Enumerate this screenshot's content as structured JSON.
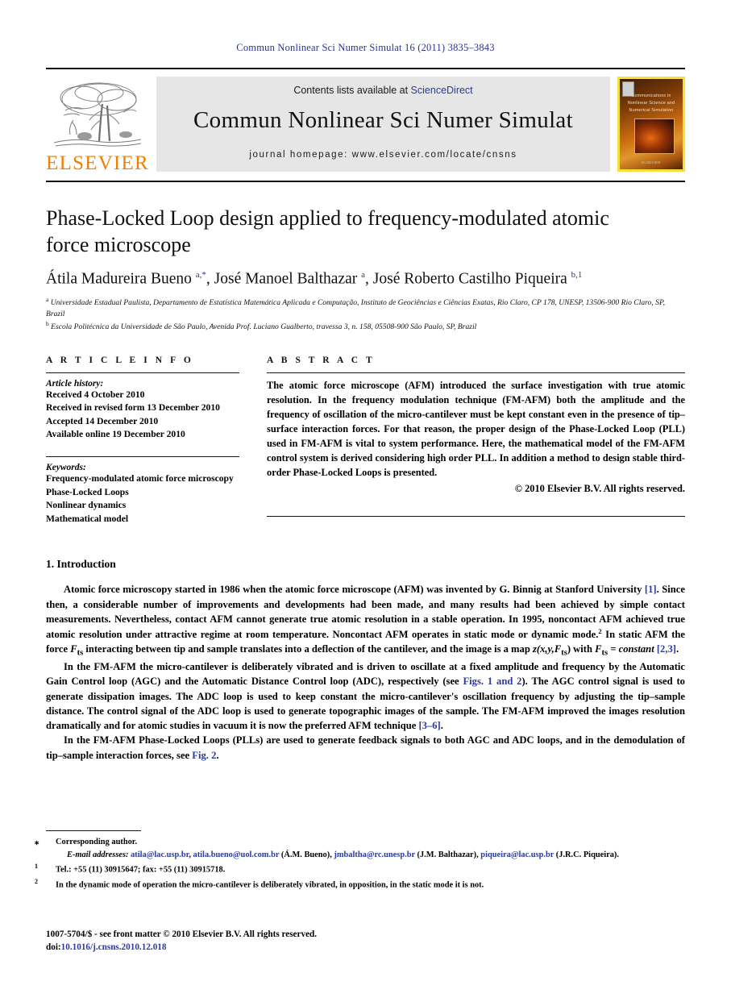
{
  "running_head": "Commun Nonlinear Sci Numer Simulat 16 (2011) 3835–3843",
  "masthead": {
    "contents_prefix": "Contents lists available at ",
    "sciencedirect": "ScienceDirect",
    "journal_name": "Commun Nonlinear Sci Numer Simulat",
    "homepage": "journal homepage: www.elsevier.com/locate/cnsns",
    "publisher_wordmark": "ELSEVIER",
    "cover_title": "Communications in Nonlinear Science and Numerical Simulation",
    "cover_footer": "ELSEVIER",
    "accent_orange": "#f08000",
    "link_blue": "#2b3a9c",
    "cover_border": "#f5e03c"
  },
  "article": {
    "title": "Phase-Locked Loop design applied to frequency-modulated atomic force microscope",
    "authors_html": "Átila Madureira Bueno <sup>a,*</sup>, José Manoel Balthazar <sup>a</sup>, José Roberto Castilho Piqueira <sup>b,1</sup>",
    "affiliation_a": "Universidade Estadual Paulista, Departamento de Estatística Matemática Aplicada e Computação, Instituto de Geociências e Ciências Exatas, Rio Claro, CP 178, UNESP, 13506-900 Rio Claro, SP, Brazil",
    "affiliation_b": "Escola Politécnica da Universidade de São Paulo, Avenida Prof. Luciano Gualberto, travessa 3, n. 158, 05508-900 São Paulo, SP, Brazil"
  },
  "article_info": {
    "heading": "A R T I C L E    I N F O",
    "history_label": "Article history:",
    "history": [
      "Received 4 October 2010",
      "Received in revised form 13 December 2010",
      "Accepted 14 December 2010",
      "Available online 19 December 2010"
    ],
    "keywords_label": "Keywords:",
    "keywords": [
      "Frequency-modulated atomic force microscopy",
      "Phase-Locked Loops",
      "Nonlinear dynamics",
      "Mathematical model"
    ]
  },
  "abstract": {
    "heading": "A B S T R A C T",
    "text": "The atomic force microscope (AFM) introduced the surface investigation with true atomic resolution. In the frequency modulation technique (FM-AFM) both the amplitude and the frequency of oscillation of the micro-cantilever must be kept constant even in the presence of tip–surface interaction forces. For that reason, the proper design of the Phase-Locked Loop (PLL) used in FM-AFM is vital to system performance. Here, the mathematical model of the FM-AFM control system is derived considering high order PLL. In addition a method to design stable third-order Phase-Locked Loops is presented.",
    "copyright": "© 2010 Elsevier B.V. All rights reserved."
  },
  "introduction": {
    "heading": "1. Introduction",
    "paragraph_1_parts": {
      "a": "Atomic force microscopy started in 1986 when the atomic force microscope (AFM) was invented by G. Binnig at Stanford University ",
      "ref1": "[1]",
      "b": ". Since then, a considerable number of improvements and developments had been made, and many results had been achieved by simple contact measurements. Nevertheless, contact AFM cannot generate true atomic resolution in a stable operation. In 1995, noncontact AFM achieved true atomic resolution under attractive regime at room temperature. Noncontact AFM operates in static mode or dynamic mode.",
      "fn2": "2",
      "c": " In static AFM the force ",
      "sym_fts1": "F",
      "sub_ts1": "ts",
      "d": " interacting between tip and sample translates into a deflection of the cantilever, and the image is a map ",
      "map": "z(x,y,F",
      "map_sub": "ts",
      "map_end": ") with ",
      "sym_fts2": "F",
      "sub_ts2": "ts",
      "e": " = constant ",
      "ref23": "[2,3]",
      "f": "."
    },
    "paragraph_2_parts": {
      "a": "In the FM-AFM the micro-cantilever is deliberately vibrated and is driven to oscillate at a fixed amplitude and frequency by the Automatic Gain Control loop (AGC) and the Automatic Distance Control loop (ADC), respectively (see ",
      "figs": "Figs. 1 and 2",
      "b": "). The AGC control signal is used to generate dissipation images. The ADC loop is used to keep constant the micro-cantilever's oscillation frequency by adjusting the tip–sample distance. The control signal of the ADC loop is used to generate topographic images of the sample. The FM-AFM improved the images resolution dramatically and for atomic studies in vacuum it is now the preferred AFM technique ",
      "ref36": "[3–6]",
      "c": "."
    },
    "paragraph_3_parts": {
      "a": "In the FM-AFM Phase-Locked Loops (PLLs) are used to generate feedback signals to both AGC and ADC loops, and in the demodulation of tip–sample interaction forces, see ",
      "fig2": "Fig. 2",
      "b": "."
    }
  },
  "footnotes": {
    "corresponding": "Corresponding author.",
    "corresponding_mark": "⁎",
    "email_label": "E-mail addresses:",
    "emails": [
      {
        "address": "atila@lac.usp.br",
        "sep": ", "
      },
      {
        "address": "atila.bueno@uol.com.br",
        "sep": " (Á.M. Bueno), "
      },
      {
        "address": "jmbaltha@rc.unesp.br",
        "sep": " (J.M. Balthazar), "
      },
      {
        "address": "piqueira@lac.usp.br",
        "sep": " (J.R.C. Piqueira)."
      }
    ],
    "note1_mark": "1",
    "note1": "Tel.: +55 (11) 30915647; fax: +55 (11) 30915718.",
    "note2_mark": "2",
    "note2": "In the dynamic mode of operation the micro-cantilever is deliberately vibrated, in opposition, in the static mode it is not."
  },
  "imprint": {
    "line1": "1007-5704/$ - see front matter © 2010 Elsevier B.V. All rights reserved.",
    "doi_label": "doi:",
    "doi_value": "10.1016/j.cnsns.2010.12.018"
  }
}
